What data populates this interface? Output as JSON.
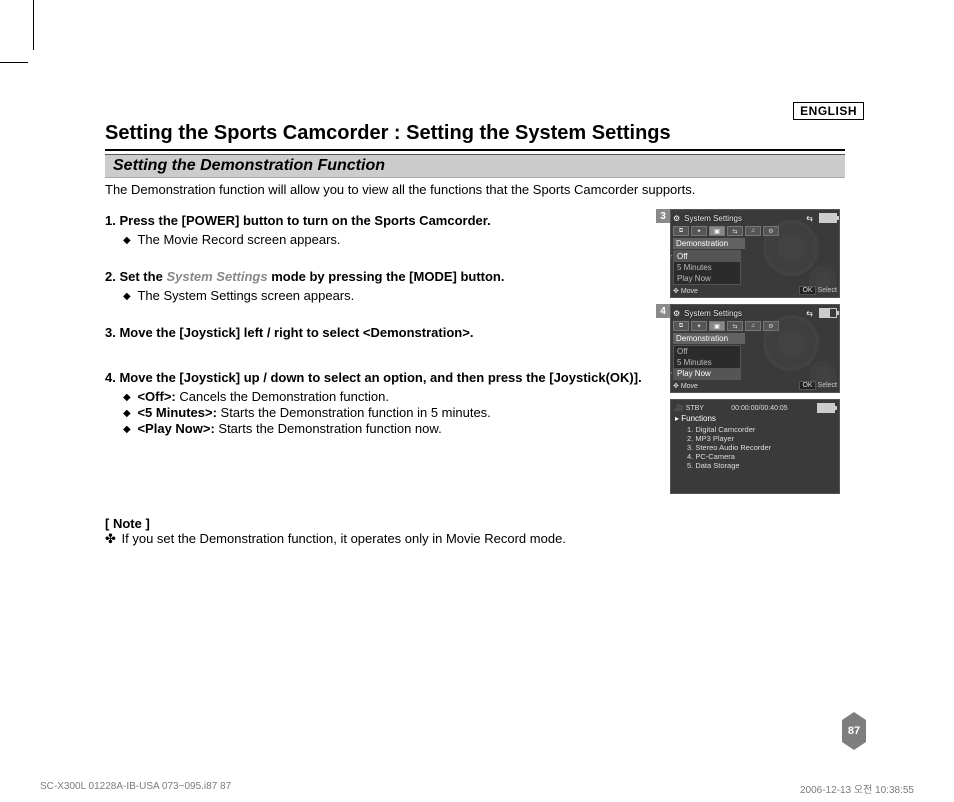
{
  "language_label": "ENGLISH",
  "main_title": "Setting the Sports Camcorder : Setting the System Settings",
  "subsection_title": "Setting the Demonstration Function",
  "intro": "The Demonstration function will allow you to view all the functions that the Sports Camcorder supports.",
  "steps": [
    {
      "head": "Press the [POWER] button to turn on the Sports Camcorder.",
      "bullets": [
        "The Movie Record screen appears."
      ]
    },
    {
      "head_pre": "Set the ",
      "head_em": "System Settings",
      "head_post": " mode by pressing the [MODE] button.",
      "bullets": [
        "The System Settings screen appears."
      ]
    },
    {
      "head": "Move the [Joystick] left / right to select <Demonstration>.",
      "bullets": []
    },
    {
      "head": "Move the [Joystick] up / down to select an option, and then press the [Joystick(OK)].",
      "options": [
        {
          "label": "<Off>:",
          "desc": " Cancels the Demonstration function."
        },
        {
          "label": "<5 Minutes>:",
          "desc": " Starts the Demonstration function in 5 minutes."
        },
        {
          "label": "<Play Now>:",
          "desc": " Starts the Demonstration function now."
        }
      ]
    }
  ],
  "note_head": "[ Note ]",
  "note_body": "If you set the Demonstration function, it operates only in Movie Record mode.",
  "figures": {
    "screen_title": "System Settings",
    "section_label": "Demonstration",
    "menu_items": [
      "Off",
      "5 Minutes",
      "Play Now"
    ],
    "move_label": "Move",
    "select_label": "Select",
    "ok_label": "OK",
    "fig3_num": "3",
    "fig3_selected_index": 0,
    "fig4_num": "4",
    "fig4_selected_index": 2,
    "demo": {
      "stby": "STBY",
      "timecode": "00:00:00/00:40:05",
      "title": "Functions",
      "list": [
        "1. Digital Camcorder",
        "2. MP3 Player",
        "3. Stereo Audio Recorder",
        "4. PC-Camera",
        "5. Data Storage"
      ]
    }
  },
  "page_number": "87",
  "footer_left": "SC-X300L 01228A-IB-USA 073~095.i87   87",
  "footer_right": "2006-12-13   오전 10:38:55"
}
